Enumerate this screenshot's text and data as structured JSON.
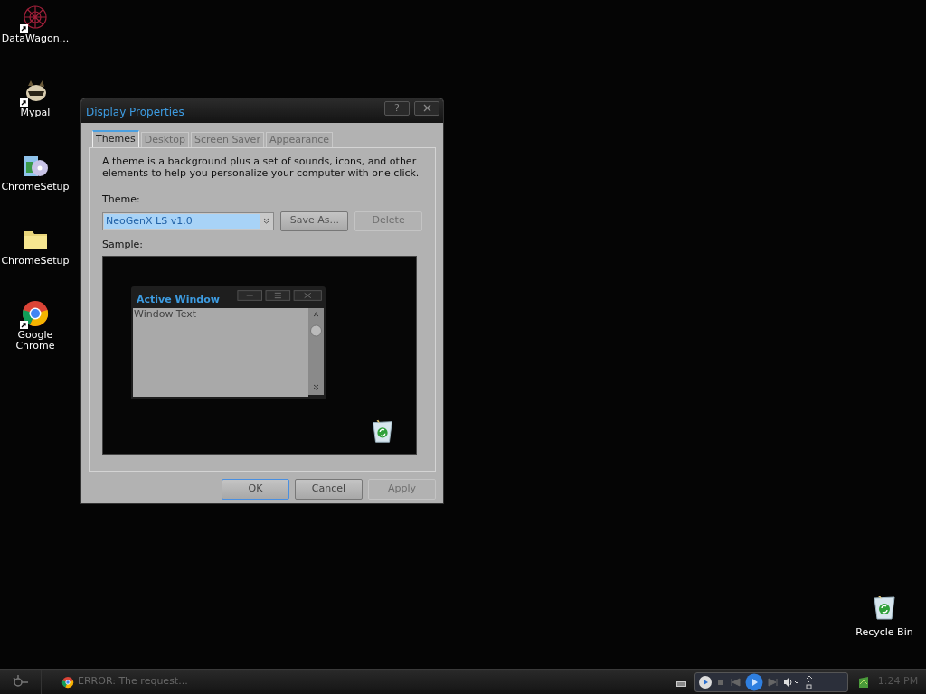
{
  "desktop_icons": [
    {
      "label": "DataWagon...",
      "kind": "web",
      "shortcut": true
    },
    {
      "label": "Mypal",
      "kind": "mascot",
      "shortcut": true
    },
    {
      "label": "ChromeSetup",
      "kind": "installer",
      "shortcut": false
    },
    {
      "label": "ChromeSetup",
      "kind": "folder",
      "shortcut": false
    },
    {
      "label": "Google Chrome",
      "kind": "chrome",
      "shortcut": true
    }
  ],
  "dialog": {
    "title": "Display Properties",
    "help_button": "?",
    "tabs": [
      {
        "label": "Themes",
        "selected": true,
        "disabled": false
      },
      {
        "label": "Desktop",
        "selected": false,
        "disabled": true
      },
      {
        "label": "Screen Saver",
        "selected": false,
        "disabled": true
      },
      {
        "label": "Appearance",
        "selected": false,
        "disabled": true
      }
    ],
    "description": "A theme is a background plus a set of sounds, icons, and other elements to help you personalize your computer with one click.",
    "theme_label": "Theme:",
    "theme_value": "NeoGenX LS v1.0",
    "theme_buttons": [
      {
        "label": "Save As...",
        "disabled": false
      },
      {
        "label": "Delete",
        "disabled": true
      }
    ],
    "sample_label": "Sample:",
    "sample": {
      "window_title": "Active Window",
      "window_text": "Window Text"
    },
    "buttons": [
      {
        "label": "OK",
        "disabled": false,
        "default": true
      },
      {
        "label": "Cancel",
        "disabled": false,
        "default": false
      },
      {
        "label": "Apply",
        "disabled": true,
        "default": false
      }
    ]
  },
  "recycle_bin": {
    "label": "Recycle Bin"
  },
  "taskbar": {
    "task": "ERROR: The request...",
    "clock": "1:24 PM"
  }
}
